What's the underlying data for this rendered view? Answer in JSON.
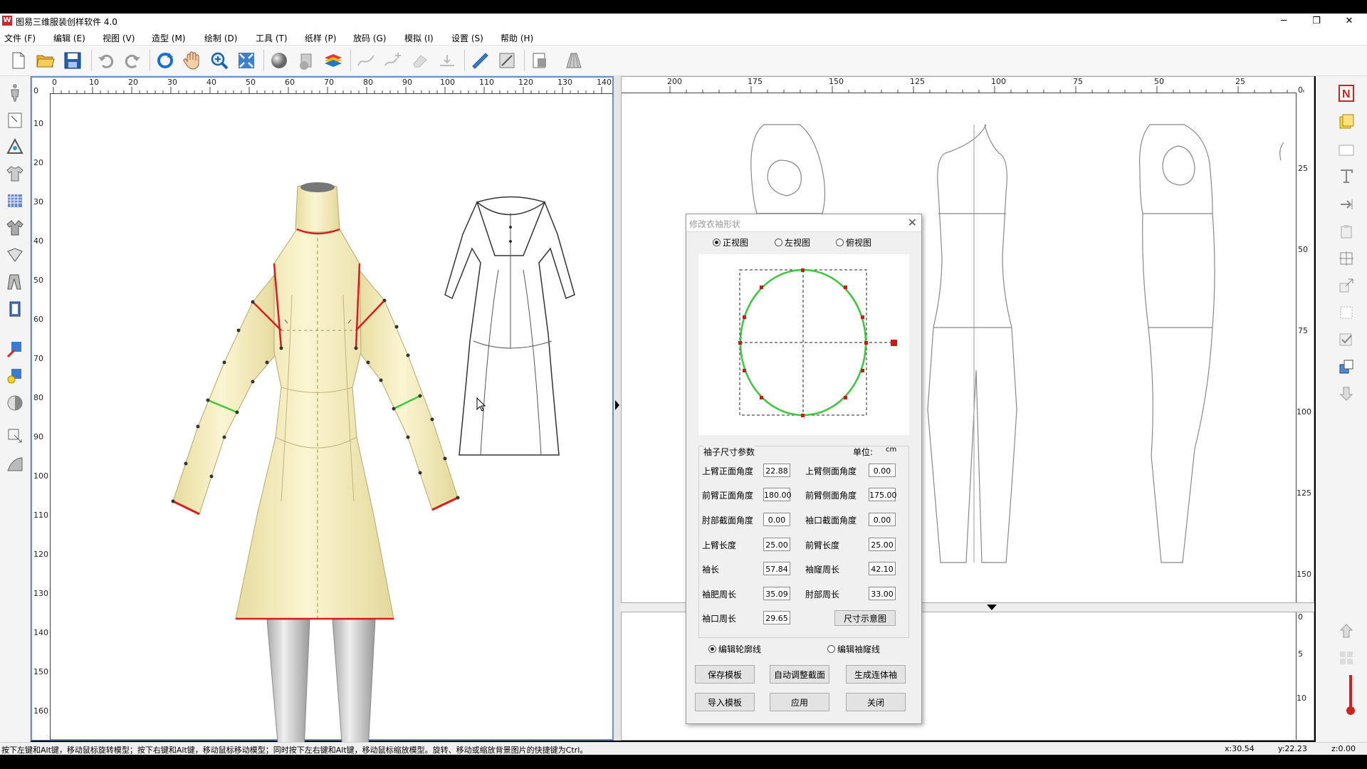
{
  "app": {
    "title": "图易三维服装创样软件 4.0",
    "logo_text": "W"
  },
  "window_controls": {
    "minimize": "─",
    "maximize": "❐",
    "close": "✕"
  },
  "menu": [
    "文件 (F)",
    "编辑 (E)",
    "视图 (V)",
    "造型 (M)",
    "绘制 (D)",
    "工具 (T)",
    "纸样 (P)",
    "放码 (G)",
    "模拟 (I)",
    "设置 (S)",
    "帮助 (H)"
  ],
  "toolbar_icons": [
    "new-file-icon",
    "open-folder-icon",
    "save-icon",
    "undo-icon",
    "redo-icon",
    "rotate-view-icon",
    "pan-hand-icon",
    "zoom-icon",
    "fit-view-icon",
    "sphere-icon",
    "model-icon",
    "layers-icon",
    "curve-icon",
    "add-point-icon",
    "eraser-icon",
    "align-icon",
    "ruler-icon",
    "measure-icon",
    "pattern-export-icon",
    "skirt-icon"
  ],
  "left_tools": [
    "body-model-icon",
    "select-tool-icon",
    "dart-tool-icon",
    "shirt-tool-icon",
    "fabric-tool-icon",
    "jacket-tool-icon",
    "collar-tool-icon",
    "pants-tool-icon",
    "vest-tool-icon",
    "cube-red-icon",
    "cube-bulb-icon",
    "shading-icon",
    "transform-icon",
    "slope-icon"
  ],
  "right_tools": [
    "north-icon",
    "layer-icon",
    "rectangle-icon",
    "text-icon",
    "arrow-icon",
    "paste-icon",
    "frame-icon",
    "scale-icon",
    "border-icon",
    "check-icon",
    "copy-icon",
    "down-icon",
    "up-icon",
    "grid-icon",
    "thermometer-icon"
  ],
  "ruler_left_view": {
    "top": [
      "0",
      "10",
      "20",
      "30",
      "40",
      "50",
      "60",
      "70",
      "80",
      "90",
      "100",
      "110",
      "120",
      "130",
      "140"
    ],
    "left": [
      "0",
      "10",
      "20",
      "30",
      "40",
      "50",
      "60",
      "70",
      "80",
      "90",
      "100",
      "110",
      "120",
      "130",
      "140",
      "150",
      "160"
    ]
  },
  "ruler_right_view": {
    "top": [
      "200",
      "175",
      "150",
      "125",
      "100",
      "75",
      "50",
      "25",
      "0"
    ],
    "right": [
      "0",
      "25",
      "50",
      "75",
      "100",
      "125",
      "150"
    ],
    "right_bottom": [
      "0",
      "5",
      "10"
    ]
  },
  "dialog": {
    "title": "修改衣袖形状",
    "views": [
      {
        "label": "正视图",
        "selected": true
      },
      {
        "label": "左视图",
        "selected": false
      },
      {
        "label": "俯视图",
        "selected": false
      }
    ],
    "group_title": "袖子尺寸参数",
    "unit_label": "单位:",
    "unit_value": "cm",
    "params": [
      {
        "label": "上臂正面角度",
        "value": "22.88",
        "label2": "上臂侧面角度",
        "value2": "0.00"
      },
      {
        "label": "前臂正面角度",
        "value": "180.00",
        "label2": "前臂侧面角度",
        "value2": "175.00"
      },
      {
        "label": "肘部截面角度",
        "value": "0.00",
        "label2": "袖口截面角度",
        "value2": "0.00"
      },
      {
        "label": "上臂长度",
        "value": "25.00",
        "label2": "前臂长度",
        "value2": "25.00"
      },
      {
        "label": "袖长",
        "value": "57.84",
        "label2": "袖窿周长",
        "value2": "42.10"
      },
      {
        "label": "袖肥周长",
        "value": "35.09",
        "label2": "肘部周长",
        "value2": "33.00"
      },
      {
        "label": "袖口周长",
        "value": "29.65",
        "label2": "",
        "value2": ""
      }
    ],
    "size_diagram_button": "尺寸示意图",
    "edit_modes": [
      {
        "label": "编辑轮廓线",
        "selected": true
      },
      {
        "label": "编辑袖窿线",
        "selected": false
      }
    ],
    "buttons_row1": [
      "保存模板",
      "自动调整截面",
      "生成连体袖"
    ],
    "buttons_row2": [
      "导入模板",
      "应用",
      "关闭"
    ]
  },
  "status": {
    "hint": "按下左键和Alt键，移动鼠标旋转模型；按下右键和Alt键，移动鼠标移动模型；同时按下左右键和Alt键，移动鼠标缩放模型。旋转、移动或缩放背景图片的快捷键为Ctrl。",
    "x": "x:30.54",
    "y": "y:22.23",
    "z": "z:0.00"
  },
  "colors": {
    "accent_border": "#6b8fc9",
    "garment_fill": "#f4eec0",
    "sleeve_outline": "#d91c1c",
    "ellipse_green": "#3cc83c"
  }
}
